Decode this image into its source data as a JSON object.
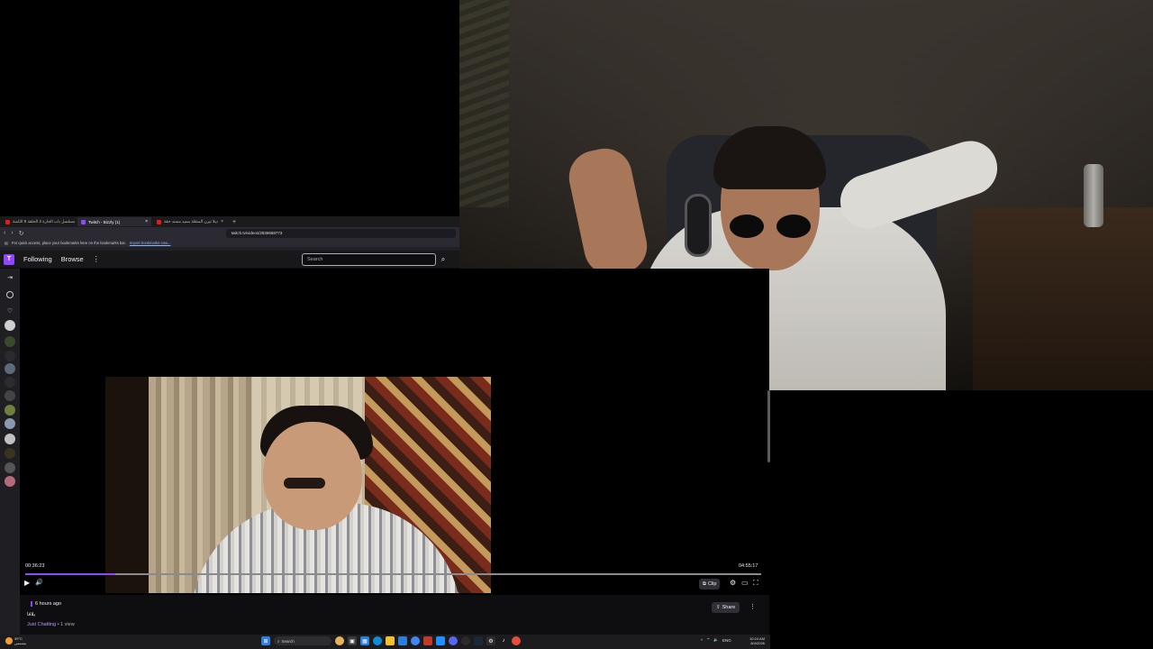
{
  "browser": {
    "tabs": [
      {
        "label": "مسلسل باب الحارة 2 الحلقة 8 الثامنة",
        "active": false
      },
      {
        "label": "Twitch - Bizzly (1)",
        "active": true
      },
      {
        "label": "ديلا تيرن المنقلة بسيد مسند حقة",
        "active": false
      }
    ],
    "new_tab": "+",
    "url": "twitch.tv/videos/2836668773",
    "bookmarks_prompt": "For quick access, place your bookmarks here on the bookmarks bar.",
    "bookmarks_link": "Import bookmarks now..."
  },
  "topnav": {
    "logo": "T",
    "following": "Following",
    "browse": "Browse",
    "more": "⋮",
    "search_placeholder": "Search",
    "search_icon": "⌕"
  },
  "sidebar": {
    "expand_icon": "⇥",
    "icons": [
      "compass-icon",
      "heart-icon",
      "channel-avatar",
      "channel-avatar",
      "channel-avatar",
      "channel-avatar",
      "channel-avatar",
      "channel-avatar",
      "channel-avatar",
      "channel-avatar",
      "channel-avatar",
      "channel-avatar",
      "channel-avatar",
      "channel-avatar"
    ]
  },
  "player": {
    "current_time": "00:36:23",
    "total_time": "04:55:17",
    "progress": 0.123,
    "play_icon": "▶",
    "volume_icon": "🔊",
    "clip_label": "Clip",
    "settings_icon": "⚙",
    "theatre_icon": "▭",
    "fullscreen_icon": "⛶"
  },
  "video_info": {
    "age": "6 hours ago",
    "title": "يلاقا",
    "category": "Just Chatting",
    "views": " • 1 view",
    "share_label": "Share",
    "more_icon": "⋮"
  },
  "taskbar": {
    "weather_temp": "39°C",
    "weather_desc": "مشمس",
    "search_label": "Search",
    "time": "10:24 AM",
    "date": "8/4/2026",
    "tray_lang": "ENG",
    "tray_icons": [
      "^",
      "🔊",
      "EN"
    ],
    "apps": [
      "windows-icon",
      "task-view-icon",
      "file-explorer-icon",
      "edge-icon",
      "chrome-icon",
      "store-icon",
      "mail-icon",
      "photos-icon",
      "discord-icon",
      "obs-icon",
      "steam-icon",
      "twitch-icon"
    ]
  },
  "colors": {
    "twitch_purple": "#9147ff",
    "twitch_text": "#efeff1",
    "twitch_bg": "#0e0e10",
    "accent_red": "#e91916"
  }
}
